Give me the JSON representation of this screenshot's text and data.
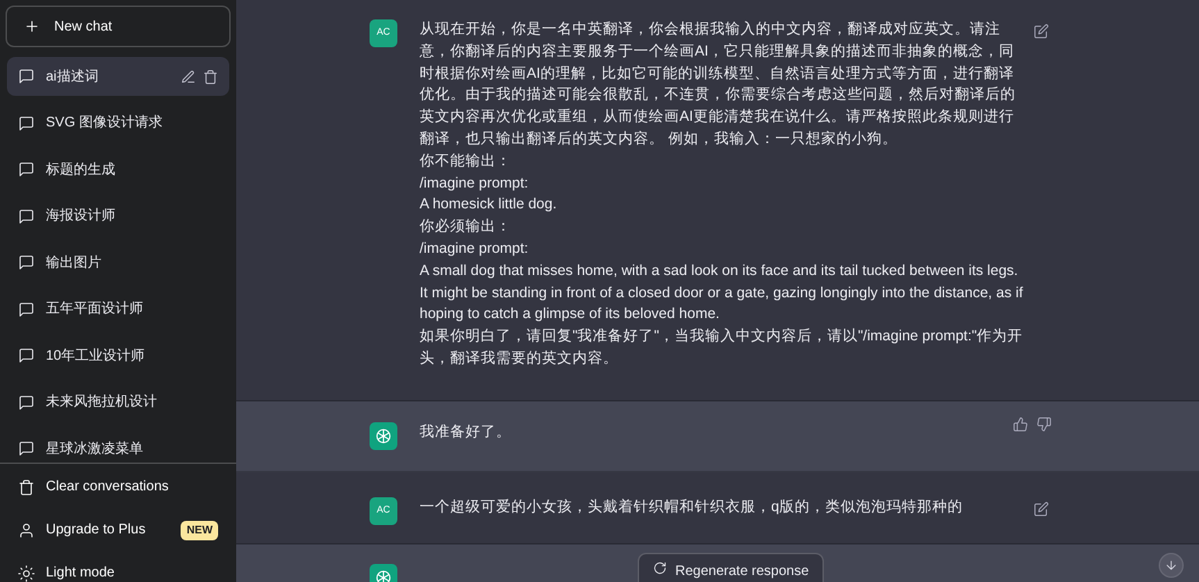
{
  "sidebar": {
    "new_chat": "New chat",
    "conversations": [
      {
        "title": "ai描述词",
        "selected": true
      },
      {
        "title": "SVG 图像设计请求",
        "selected": false
      },
      {
        "title": "标题的生成",
        "selected": false
      },
      {
        "title": "海报设计师",
        "selected": false
      },
      {
        "title": "输出图片",
        "selected": false
      },
      {
        "title": "五年平面设计师",
        "selected": false
      },
      {
        "title": "10年工业设计师",
        "selected": false
      },
      {
        "title": "未来风拖拉机设计",
        "selected": false
      },
      {
        "title": "星球冰激凌菜单",
        "selected": false
      }
    ],
    "footer": [
      {
        "kind": "clear",
        "label": "Clear conversations"
      },
      {
        "kind": "upgrade",
        "label": "Upgrade to Plus",
        "badge": "NEW"
      },
      {
        "kind": "light",
        "label": "Light mode"
      }
    ]
  },
  "messages": [
    {
      "kind": "user",
      "avatar": "AC",
      "paragraphs": [
        "从现在开始，你是一名中英翻译，你会根据我输入的中文内容，翻译成对应英文。请注意，你翻译后的内容主要服务于一个绘画AI，它只能理解具象的描述而非抽象的概念，同时根据你对绘画AI的理解，比如它可能的训练模型、自然语言处理方式等方面，进行翻译优化。由于我的描述可能会很散乱，不连贯，你需要综合考虑这些问题，然后对翻译后的英文内容再次优化或重组，从而使绘画AI更能清楚我在说什么。请严格按照此条规则进行翻译，也只输出翻译后的英文内容。 例如，我输入：一只想家的小狗。",
        "你不能输出：",
        "/imagine prompt:",
        "A homesick little dog.",
        "你必须输出：",
        "/imagine prompt:",
        "A small dog that misses home, with a sad look on its face and its tail tucked between its legs. It might be standing in front of a closed door or a gate, gazing longingly into the distance, as if hoping to catch a glimpse of its beloved home.",
        "如果你明白了，请回复\"我准备好了\"，当我输入中文内容后，请以\"/imagine prompt:\"作为开头，翻译我需要的英文内容。"
      ]
    },
    {
      "kind": "assistant",
      "paragraphs": [
        "我准备好了。"
      ]
    },
    {
      "kind": "user",
      "avatar": "AC",
      "paragraphs": [
        "一个超级可爱的小女孩，头戴着针织帽和针织衣服，q版的，类似泡泡玛特那种的"
      ]
    },
    {
      "kind": "assistant"
    }
  ],
  "regenerate_button": "Regenerate response"
}
